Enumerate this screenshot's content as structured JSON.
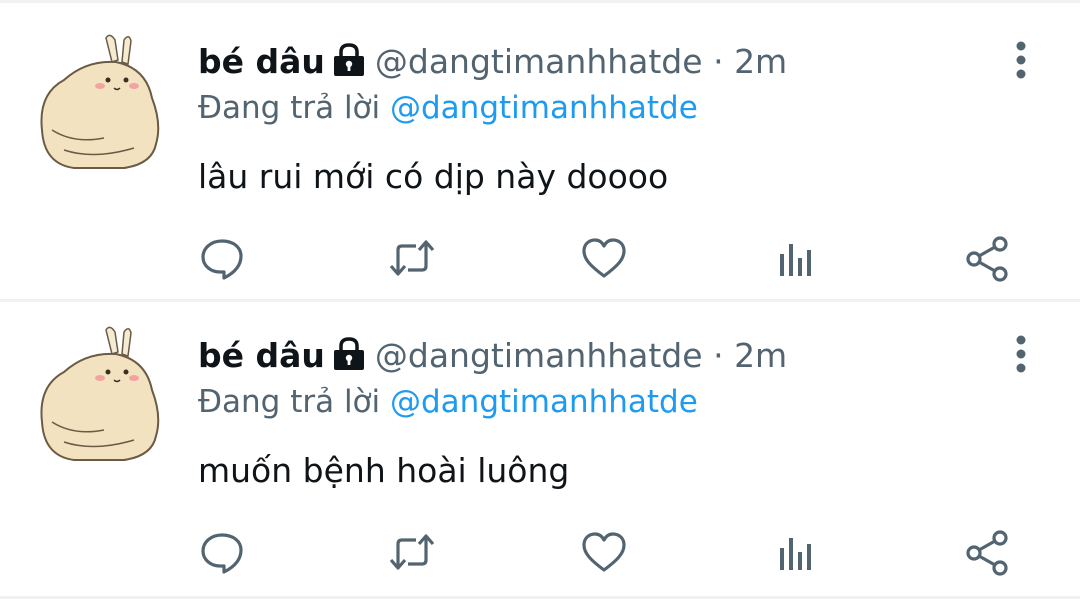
{
  "tweets": [
    {
      "display_name": "bé dâu",
      "handle": "@dangtimanhhatde",
      "separator": "·",
      "time": "2m",
      "reply_prefix": "Đang trả lời",
      "reply_to": "@dangtimanhhatde",
      "text": "lâu rui mới có dịp này doooo",
      "icons": [
        "lock-icon",
        "more-options-icon",
        "reply-icon",
        "retweet-icon",
        "like-icon",
        "analytics-icon",
        "share-icon"
      ]
    },
    {
      "display_name": "bé dâu",
      "handle": "@dangtimanhhatde",
      "separator": "·",
      "time": "2m",
      "reply_prefix": "Đang trả lời",
      "reply_to": "@dangtimanhhatde",
      "text": "muốn bệnh hoài luông",
      "icons": [
        "lock-icon",
        "more-options-icon",
        "reply-icon",
        "retweet-icon",
        "like-icon",
        "analytics-icon",
        "share-icon"
      ]
    }
  ],
  "colors": {
    "text": "#0f1419",
    "secondary": "#536471",
    "mention": "#1d9bf0",
    "divider": "#eff1f3",
    "icon": "#536471"
  }
}
